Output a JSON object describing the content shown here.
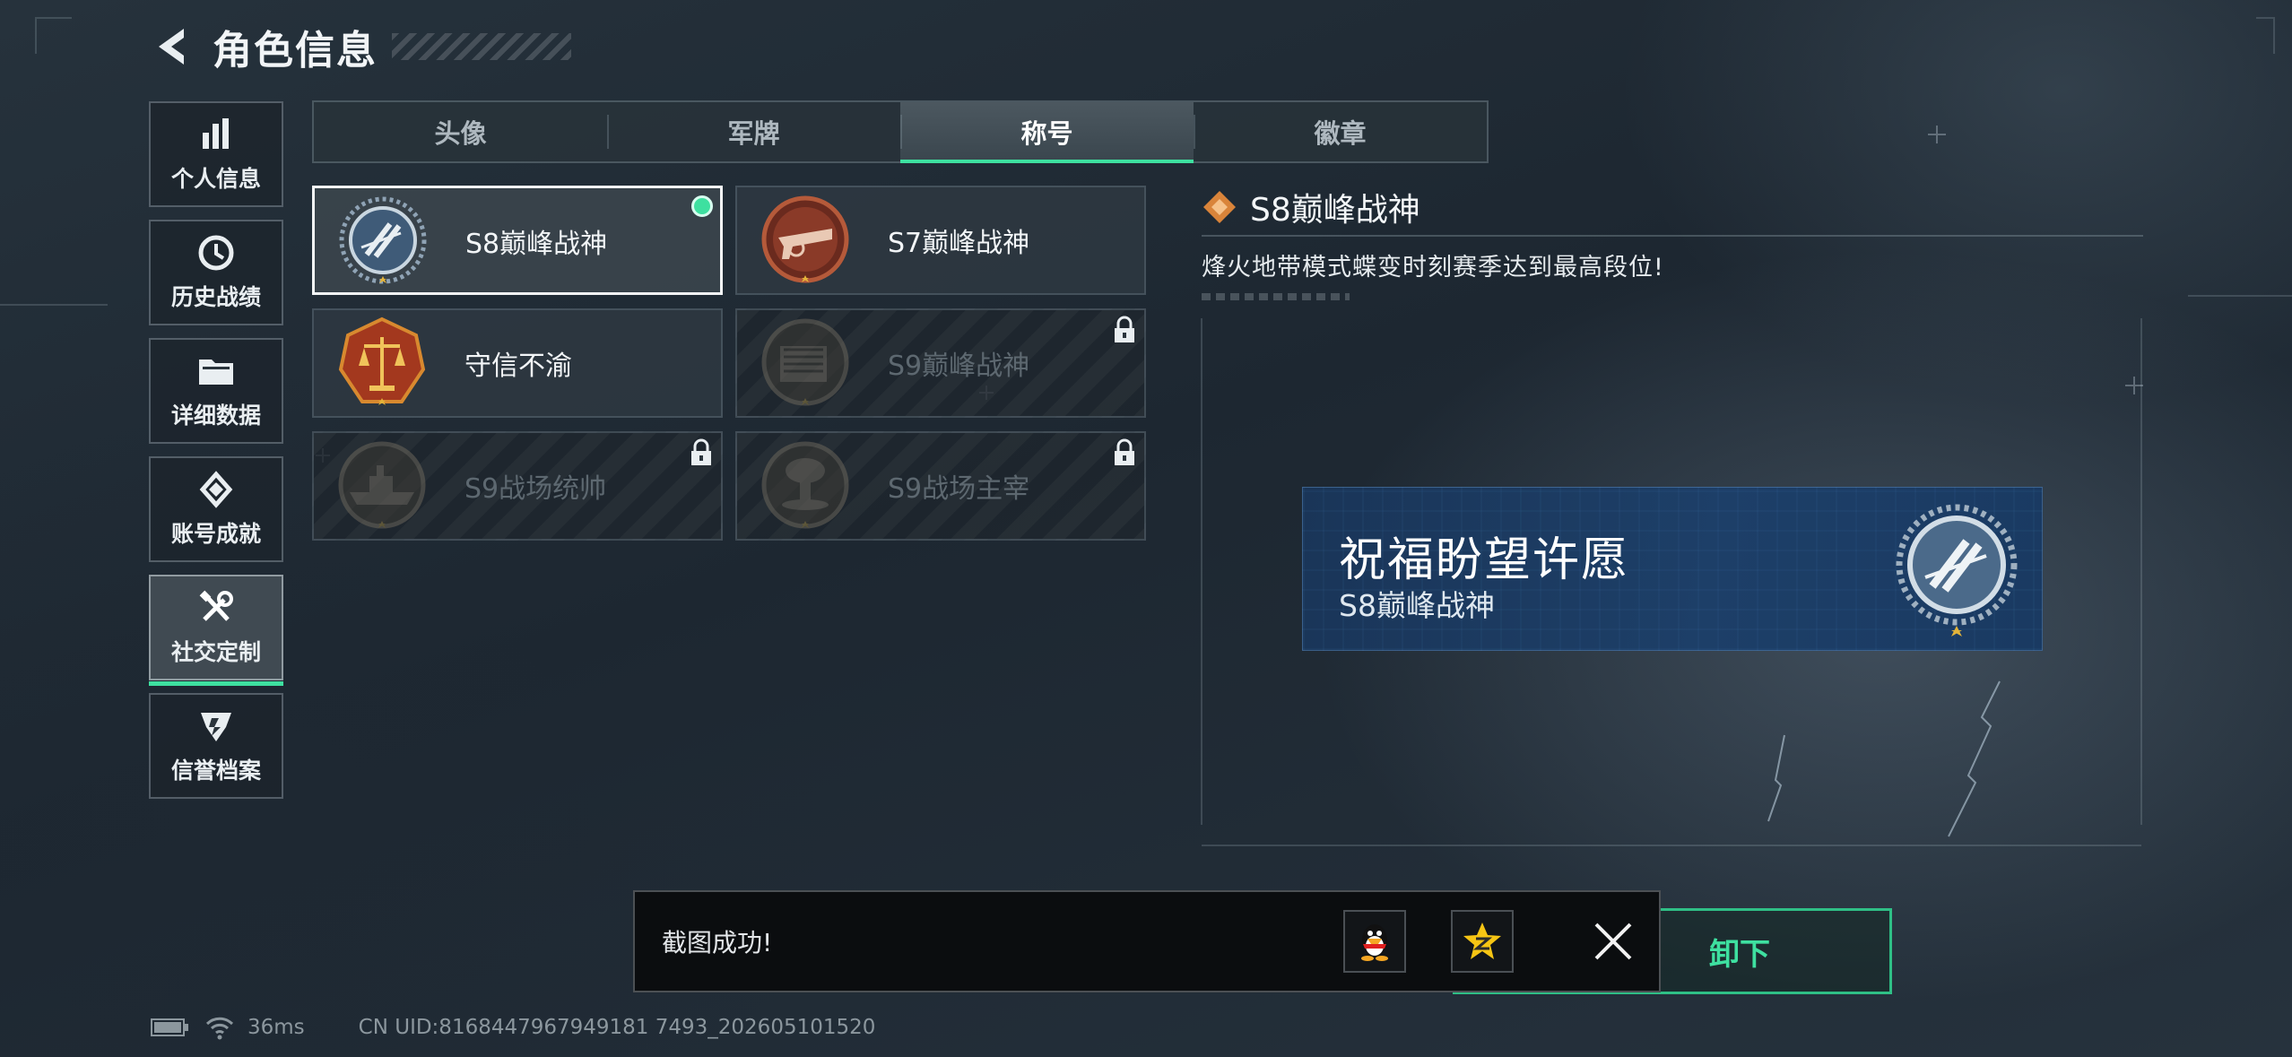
{
  "header": {
    "title": "角色信息"
  },
  "sidenav": {
    "items": [
      {
        "label": "个人信息",
        "icon": "bar-chart-icon"
      },
      {
        "label": "历史战绩",
        "icon": "history-clock-icon"
      },
      {
        "label": "详细数据",
        "icon": "folder-icon"
      },
      {
        "label": "账号成就",
        "icon": "achievement-icon"
      },
      {
        "label": "社交定制",
        "icon": "tools-icon",
        "active": true
      },
      {
        "label": "信誉档案",
        "icon": "credit-shield-icon"
      }
    ]
  },
  "tabs": [
    {
      "label": "头像"
    },
    {
      "label": "军牌"
    },
    {
      "label": "称号",
      "active": true
    },
    {
      "label": "徽章"
    }
  ],
  "titles": [
    {
      "name": "S8巅峰战神",
      "selected": true,
      "equipped": true,
      "locked": false
    },
    {
      "name": "S7巅峰战神",
      "locked": false
    },
    {
      "name": "守信不渝",
      "locked": false
    },
    {
      "name": "S9巅峰战神",
      "locked": true
    },
    {
      "name": "S9战场统帅",
      "locked": true
    },
    {
      "name": "S9战场主宰",
      "locked": true
    }
  ],
  "detail": {
    "title": "S8巅峰战神",
    "description": "烽火地带模式蝶变时刻赛季达到最高段位!"
  },
  "preview": {
    "main": "祝福盼望许愿",
    "sub": "S8巅峰战神"
  },
  "unequip": {
    "label": "卸下"
  },
  "toast": {
    "text": "截图成功!"
  },
  "status": {
    "ping": "36ms",
    "uid": "CN UID:8168447967949181 7493_202605101520"
  },
  "colors": {
    "accent": "#3ee0a0",
    "banner": "#1d3f68"
  }
}
